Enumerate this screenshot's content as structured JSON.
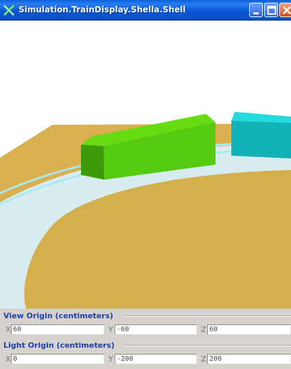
{
  "window": {
    "title": "Simulation.TrainDisplay.Shella.Shell",
    "icon": "x-logo-icon",
    "buttons": [
      "minimize",
      "maximize",
      "close"
    ]
  },
  "scene": {
    "description_icon": "3d-train-viewport",
    "colors": {
      "ground": "#d8b04f",
      "track_band": "#d7ecf1",
      "track_rail": "#a9e9ef",
      "green_car": "#66dd11",
      "teal_car": "#11c9cc"
    }
  },
  "view_origin": {
    "legend": "View Origin (centimeters)",
    "x_label": "X",
    "x_value": "60",
    "y_label": "Y",
    "y_value": "-60",
    "z_label": "Z",
    "z_value": "60"
  },
  "light_origin": {
    "legend": "Light Origin (centimeters)",
    "x_label": "X",
    "x_value": "0",
    "y_label": "Y",
    "y_value": "-200",
    "z_label": "Z",
    "z_value": "200"
  }
}
